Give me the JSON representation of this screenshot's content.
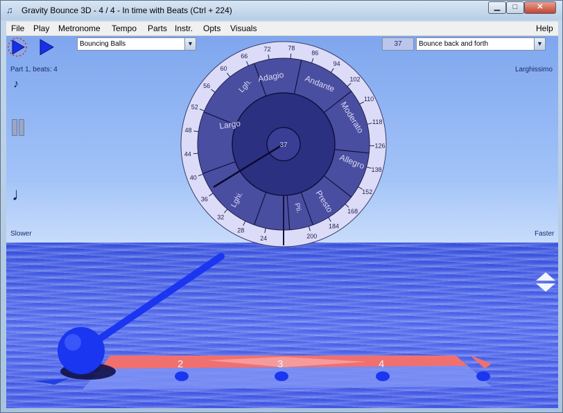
{
  "window": {
    "title": "Gravity Bounce 3D - 4 / 4 - In time with Beats (Ctrl + 224)",
    "icon": "app-logo-icon",
    "minimize": "▁",
    "maximize": "□",
    "close": "✕"
  },
  "menu": [
    "File",
    "Play",
    "Metronome",
    "Tempo",
    "Parts",
    "Instr.",
    "Opts",
    "Visuals",
    "Help"
  ],
  "toolbar": {
    "visual_select": "Bouncing Balls",
    "tempo_value": "37",
    "motion_select": "Bounce back and forth"
  },
  "status": {
    "part_beats": "Part 1, beats: 4",
    "tempo_name": "Larghissimo",
    "slower": "Slower",
    "faster": "Faster"
  },
  "dial": {
    "center_value": "37",
    "ticks": [
      "24",
      "28",
      "32",
      "36",
      "40",
      "44",
      "48",
      "52",
      "56",
      "60",
      "66",
      "72",
      "78",
      "86",
      "94",
      "102",
      "110",
      "118",
      "126",
      "138",
      "152",
      "168",
      "184",
      "200"
    ],
    "sections": [
      "Largo",
      "Lgh.",
      "Adagio",
      "Andante",
      "Moderato",
      "Allegro",
      "Presto",
      "Pti.",
      "Lghi."
    ]
  },
  "beats": [
    "2",
    "3",
    "4"
  ],
  "colors": {
    "dial_outer": "#dcdcf8",
    "dial_ring": "#4a4ea0",
    "dial_inner": "#2c3080",
    "sea": "#4a60e8",
    "sky": "#9fc0f8",
    "ball": "#1a36f0",
    "beat_bar": "#f07070"
  }
}
